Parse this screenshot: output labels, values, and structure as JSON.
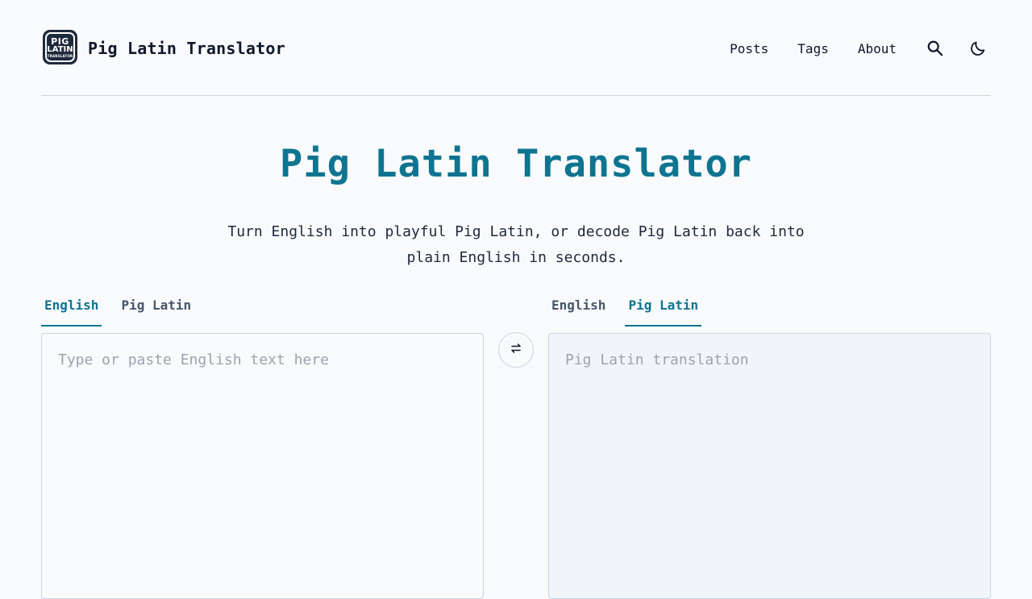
{
  "header": {
    "logo": {
      "line1": "PIG",
      "line2": "LATIN",
      "line3": "TRANSLATOR"
    },
    "brand": "Pig Latin Translator",
    "nav": [
      {
        "label": "Posts"
      },
      {
        "label": "Tags"
      },
      {
        "label": "About"
      }
    ],
    "icons": {
      "search": "search-icon",
      "theme": "moon-icon"
    }
  },
  "hero": {
    "title": "Pig Latin Translator",
    "subtitle": "Turn English into playful Pig Latin, or decode Pig Latin back into plain English in seconds."
  },
  "input_tabs": [
    {
      "label": "English",
      "active": true
    },
    {
      "label": "Pig Latin",
      "active": false
    }
  ],
  "output_tabs": [
    {
      "label": "English",
      "active": false
    },
    {
      "label": "Pig Latin",
      "active": true
    }
  ],
  "input": {
    "placeholder": "Type or paste English text here",
    "value": ""
  },
  "output": {
    "placeholder": "Pig Latin translation",
    "value": ""
  },
  "swap": {
    "icon": "swap-arrows-icon"
  },
  "colors": {
    "accent": "#0e7490",
    "border": "#cbd5e1",
    "background": "#f8fafc",
    "output_bg": "#f1f5f9"
  }
}
